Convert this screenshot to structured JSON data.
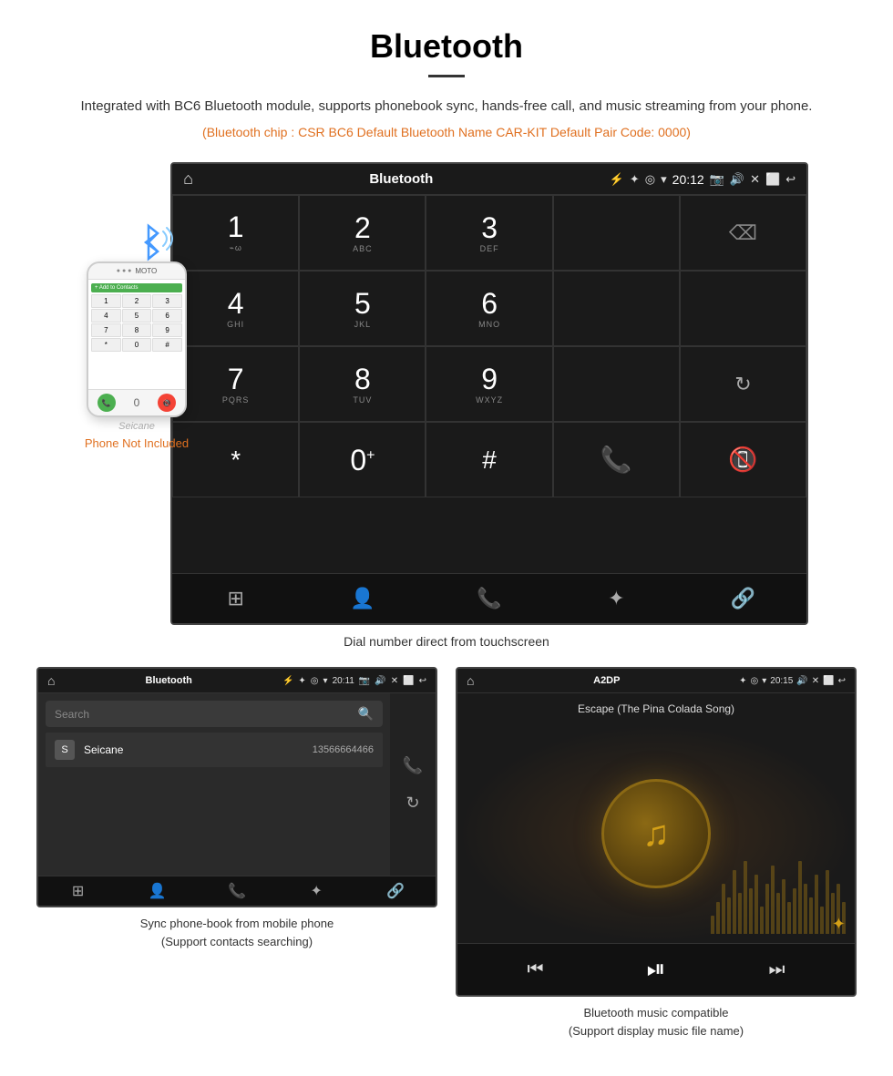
{
  "header": {
    "title": "Bluetooth",
    "description": "Integrated with BC6 Bluetooth module, supports phonebook sync, hands-free call, and music streaming from your phone.",
    "specs": "(Bluetooth chip : CSR BC6    Default Bluetooth Name CAR-KIT    Default Pair Code: 0000)"
  },
  "car_screen": {
    "status_bar": {
      "app_name": "Bluetooth",
      "time": "20:12",
      "usb_icon": "⚡"
    },
    "dialpad": {
      "keys": [
        {
          "num": "1",
          "sub": "⌁"
        },
        {
          "num": "2",
          "sub": "ABC"
        },
        {
          "num": "3",
          "sub": "DEF"
        },
        {
          "num": "",
          "sub": ""
        },
        {
          "num": "",
          "sub": "",
          "type": "backspace"
        },
        {
          "num": "4",
          "sub": "GHI"
        },
        {
          "num": "5",
          "sub": "JKL"
        },
        {
          "num": "6",
          "sub": "MNO"
        },
        {
          "num": "",
          "sub": ""
        },
        {
          "num": "",
          "sub": ""
        },
        {
          "num": "7",
          "sub": "PQRS"
        },
        {
          "num": "8",
          "sub": "TUV"
        },
        {
          "num": "9",
          "sub": "WXYZ"
        },
        {
          "num": "",
          "sub": ""
        },
        {
          "num": "",
          "sub": "",
          "type": "refresh"
        },
        {
          "num": "*",
          "sub": ""
        },
        {
          "num": "0",
          "sub": "+"
        },
        {
          "num": "#",
          "sub": ""
        },
        {
          "num": "",
          "sub": "",
          "type": "call_green"
        },
        {
          "num": "",
          "sub": "",
          "type": "call_red"
        }
      ],
      "bottom_nav": [
        "⊞",
        "👤",
        "📞",
        "✦",
        "🔗"
      ]
    }
  },
  "main_caption": "Dial number direct from touchscreen",
  "phone_not_included": "Phone Not Included",
  "seicane_label": "Seicane",
  "phonebook_screen": {
    "status_bar": {
      "app_name": "Bluetooth",
      "time": "20:11"
    },
    "search_placeholder": "Search",
    "contacts": [
      {
        "initial": "S",
        "name": "Seicane",
        "number": "13566664466"
      }
    ],
    "caption_line1": "Sync phone-book from mobile phone",
    "caption_line2": "(Support contacts searching)"
  },
  "music_screen": {
    "status_bar": {
      "app_name": "A2DP",
      "time": "20:15"
    },
    "song_title": "Escape (The Pina Colada Song)",
    "caption_line1": "Bluetooth music compatible",
    "caption_line2": "(Support display music file name)"
  },
  "eq_heights": [
    20,
    35,
    55,
    40,
    70,
    45,
    80,
    50,
    65,
    30,
    55,
    75,
    45,
    60,
    35,
    50,
    80,
    55,
    40,
    65,
    30,
    70,
    45,
    55,
    35
  ]
}
